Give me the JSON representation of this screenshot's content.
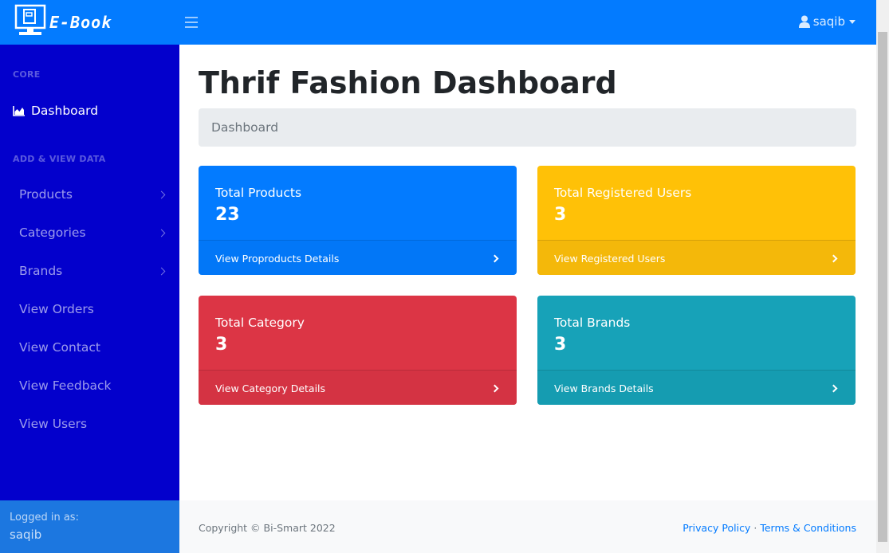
{
  "navbar": {
    "brand": "E-Book",
    "user": "saqib"
  },
  "sidebar": {
    "heading_core": "CORE",
    "dashboard": "Dashboard",
    "heading_data": "ADD & VIEW DATA",
    "items": [
      {
        "label": "Products",
        "has_chevron": true
      },
      {
        "label": "Categories",
        "has_chevron": true
      },
      {
        "label": "Brands",
        "has_chevron": true
      },
      {
        "label": "View Orders",
        "has_chevron": false
      },
      {
        "label": "View Contact",
        "has_chevron": false
      },
      {
        "label": "View Feedback",
        "has_chevron": false
      },
      {
        "label": "View Users",
        "has_chevron": false
      }
    ],
    "footer_label": "Logged in as:",
    "footer_user": "saqib"
  },
  "main": {
    "title": "Thrif Fashion Dashboard",
    "breadcrumb": "Dashboard",
    "cards": [
      {
        "label": "Total Products",
        "value": "23",
        "link": "View Proproducts Details",
        "color": "#037bff"
      },
      {
        "label": "Total Registered Users",
        "value": "3",
        "link": "View Registered Users",
        "color": "#ffc107"
      },
      {
        "label": "Total Category",
        "value": "3",
        "link": "View Category Details",
        "color": "#dc3545"
      },
      {
        "label": "Total Brands",
        "value": "3",
        "link": "View Brands Details",
        "color": "#17a2b8"
      }
    ]
  },
  "footer": {
    "copyright": "Copyright © Bi-Smart 2022",
    "privacy": "Privacy Policy",
    "separator": "·",
    "terms": "Terms & Conditions"
  },
  "icons": {
    "brand": "computer-book-icon",
    "toggle": "hamburger-icon",
    "user": "user-icon",
    "dashboard": "area-chart-icon",
    "chevron": "chevron-right-icon"
  }
}
